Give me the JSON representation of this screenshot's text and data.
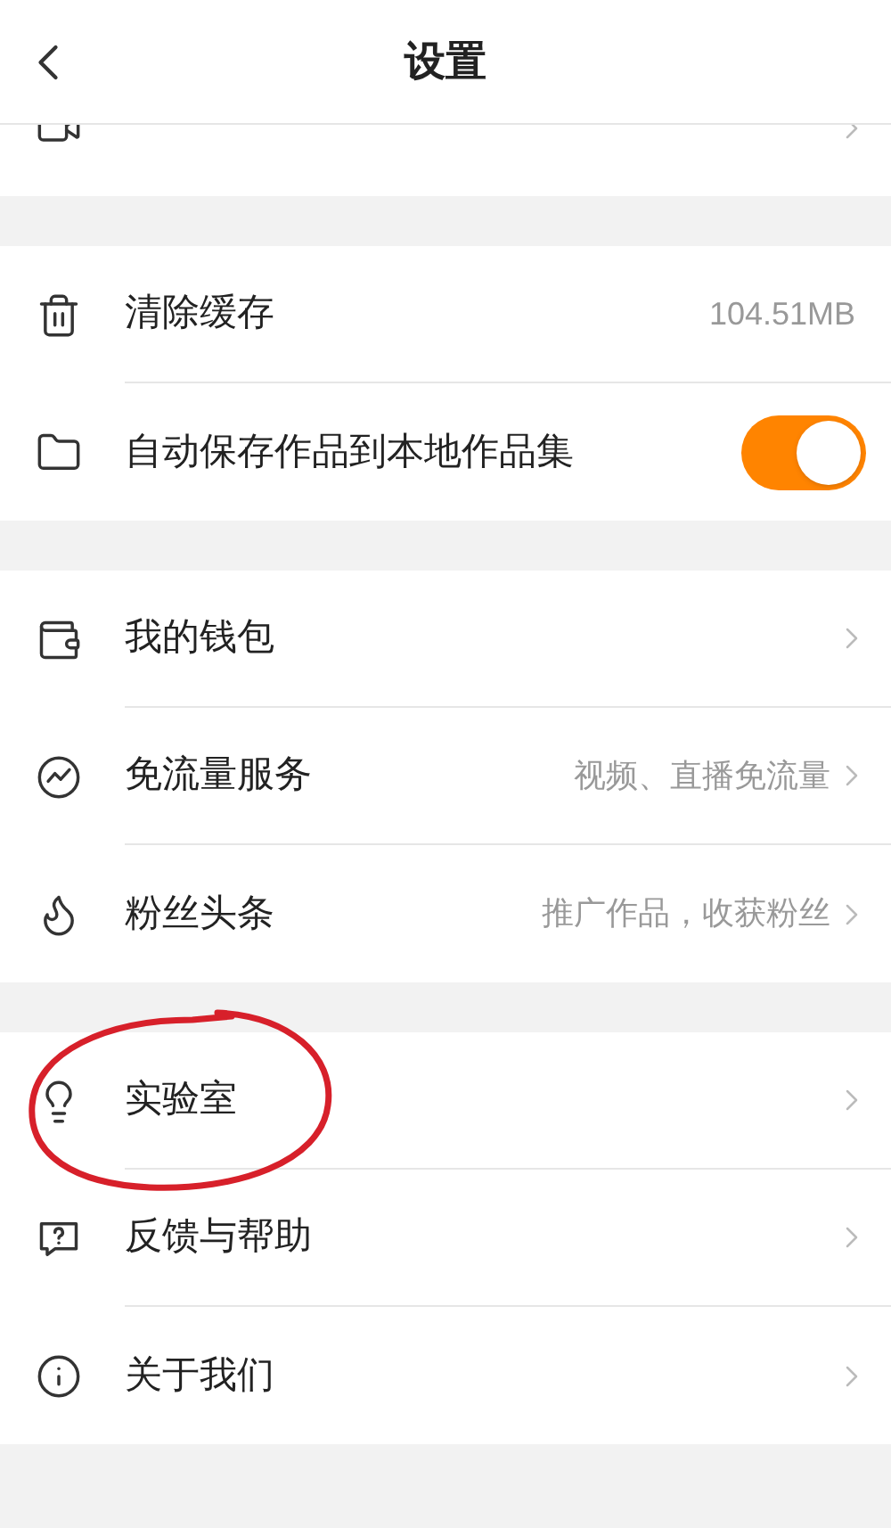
{
  "header": {
    "title": "设置"
  },
  "groups": [
    {
      "rows": [
        {
          "kind": "link"
        }
      ]
    },
    {
      "rows": [
        {
          "kind": "info",
          "label": "清除缓存",
          "value": "104.51MB"
        },
        {
          "kind": "switch",
          "label": "自动保存作品到本地作品集",
          "on": true
        }
      ]
    },
    {
      "rows": [
        {
          "kind": "link",
          "label": "我的钱包"
        },
        {
          "kind": "link",
          "label": "免流量服务",
          "value": "视频、直播免流量"
        },
        {
          "kind": "link",
          "label": "粉丝头条",
          "value": "推广作品，收获粉丝"
        }
      ]
    },
    {
      "rows": [
        {
          "kind": "link",
          "label": "实验室"
        },
        {
          "kind": "link",
          "label": "反馈与帮助"
        },
        {
          "kind": "link",
          "label": "关于我们"
        }
      ]
    }
  ]
}
